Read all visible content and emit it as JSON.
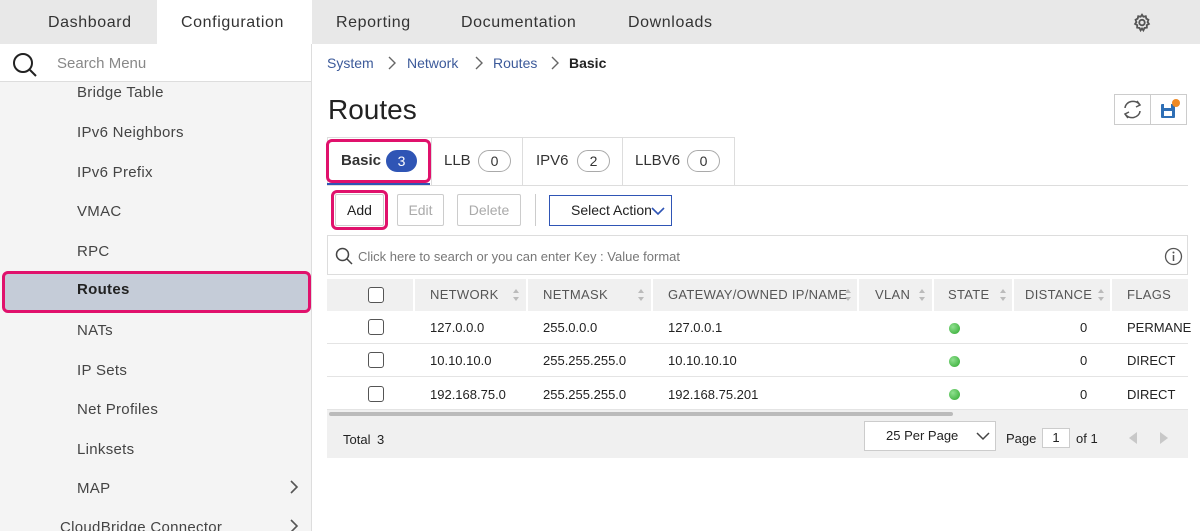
{
  "topnav": {
    "tabs": [
      {
        "label": "Dashboard"
      },
      {
        "label": "Configuration"
      },
      {
        "label": "Reporting"
      },
      {
        "label": "Documentation"
      },
      {
        "label": "Downloads"
      }
    ],
    "active_tab": "Configuration",
    "settings_icon": "gear-icon"
  },
  "sidebar": {
    "search_placeholder": "Search Menu",
    "items": [
      {
        "label": "Bridge Table"
      },
      {
        "label": "IPv6 Neighbors"
      },
      {
        "label": "IPv6 Prefix"
      },
      {
        "label": "VMAC"
      },
      {
        "label": "RPC"
      },
      {
        "label": "Routes"
      },
      {
        "label": "NATs"
      },
      {
        "label": "IP Sets"
      },
      {
        "label": "Net Profiles"
      },
      {
        "label": "Linksets"
      },
      {
        "label": "MAP"
      },
      {
        "label": "CloudBridge Connector"
      }
    ],
    "active_item": "Routes"
  },
  "breadcrumb": [
    {
      "label": "System"
    },
    {
      "label": "Network"
    },
    {
      "label": "Routes"
    },
    {
      "label": "Basic"
    }
  ],
  "page_title": "Routes",
  "route_tabs": [
    {
      "label": "Basic",
      "count": "3"
    },
    {
      "label": "LLB",
      "count": "0"
    },
    {
      "label": "IPV6",
      "count": "2"
    },
    {
      "label": "LLBV6",
      "count": "0"
    }
  ],
  "toolbar": {
    "add": "Add",
    "edit": "Edit",
    "delete": "Delete",
    "select_action": "Select Action"
  },
  "search": {
    "placeholder": "Click here to search or you can enter Key : Value format"
  },
  "table": {
    "columns": [
      "NETWORK",
      "NETMASK",
      "GATEWAY/OWNED IP/NAME",
      "VLAN",
      "STATE",
      "DISTANCE",
      "FLAGS"
    ],
    "rows": [
      {
        "network": "127.0.0.0",
        "netmask": "255.0.0.0",
        "gateway": "127.0.0.1",
        "vlan": "",
        "state": "up",
        "distance": "0",
        "flags": "PERMANE"
      },
      {
        "network": "10.10.10.0",
        "netmask": "255.255.255.0",
        "gateway": "10.10.10.10",
        "vlan": "",
        "state": "up",
        "distance": "0",
        "flags": "DIRECT"
      },
      {
        "network": "192.168.75.0",
        "netmask": "255.255.255.0",
        "gateway": "192.168.75.201",
        "vlan": "",
        "state": "up",
        "distance": "0",
        "flags": "DIRECT"
      }
    ]
  },
  "footer": {
    "total_label": "Total",
    "total": "3",
    "per_page": "25 Per Page",
    "page_label": "Page",
    "page": "1",
    "of_label": "of 1"
  },
  "colors": {
    "accent": "#2f55b5",
    "highlight": "#e0116c",
    "link": "#3c5a9a",
    "status_up": "#2ea82e"
  }
}
